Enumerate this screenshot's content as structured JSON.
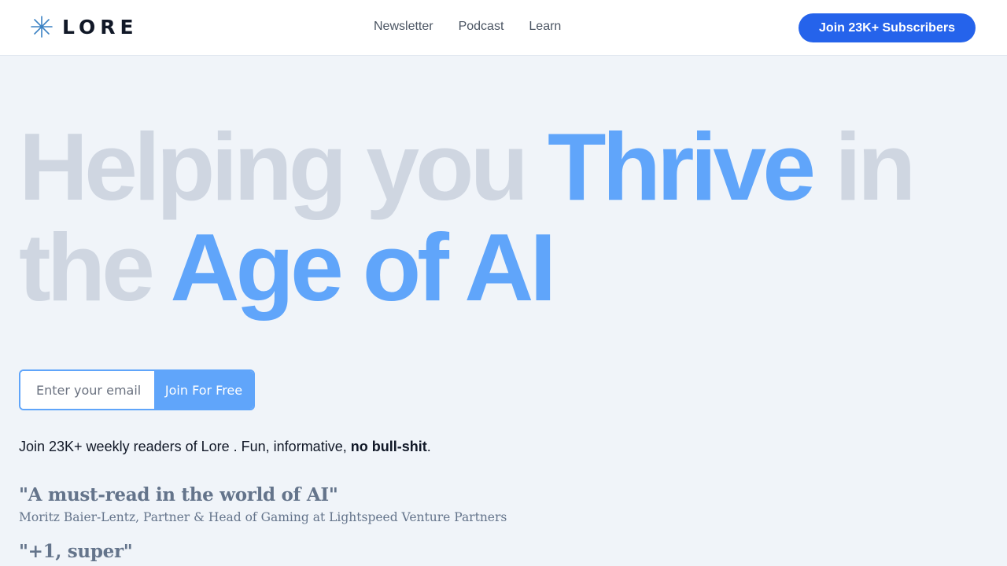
{
  "header": {
    "logo_text": "LORE",
    "logo_icon": "asterisk-star-icon",
    "nav": [
      "Newsletter",
      "Podcast",
      "Learn"
    ],
    "cta_label": "Join 23K+ Subscribers"
  },
  "hero": {
    "line1": {
      "a": "Helping you ",
      "b": "Thrive",
      "c": " in"
    },
    "line2": {
      "a": "the ",
      "b": "Age of AI"
    }
  },
  "signup": {
    "email_placeholder": "Enter your email",
    "button_label": "Join For Free"
  },
  "subtitle": {
    "text": "Join 23K+ weekly readers of Lore . Fun, informative, ",
    "bold": "no bull-shit",
    "end": "."
  },
  "testimonials": [
    {
      "quote": "\"A must-read in the world of AI\"",
      "author": "Moritz Baier-Lentz, Partner & Head of Gaming at Lightspeed Venture Partners"
    },
    {
      "quote": "\"+1, super\""
    }
  ],
  "colors": {
    "accent": "#2563eb",
    "highlight": "#60a5fa",
    "muted_headline": "#cfd6e1",
    "background": "#f0f4f9"
  }
}
